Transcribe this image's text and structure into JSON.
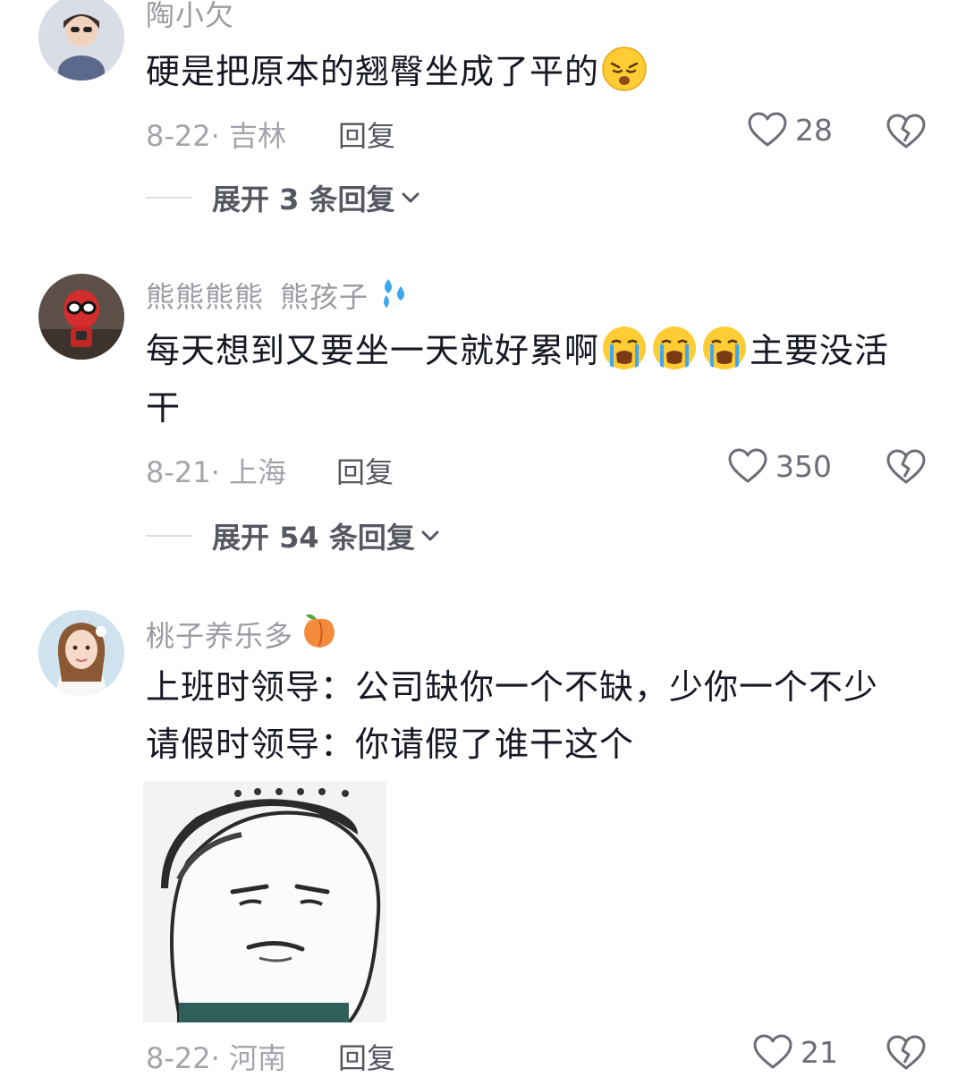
{
  "comments": [
    {
      "username": "陶小欠",
      "username_suffix": "",
      "text_before_emoji": "硬是把原本的翘臀坐成了平的",
      "emoji_icon": "tired-face-emoji",
      "date_location": "8-22· 吉林",
      "reply_label": "回复",
      "likes": "28",
      "expand_label": "展开 3 条回复"
    },
    {
      "username": "熊熊熊熊",
      "username_suffix": "熊孩子",
      "username_emoji": "sweat-droplets-emoji",
      "text_line1_before": "每天想到又要坐一天就好累啊",
      "emoji_icon": "loudly-crying-face-emoji",
      "text_line1_after": "主要没活",
      "text_line2": "干",
      "date_location": "8-21· 上海",
      "reply_label": "回复",
      "likes": "350",
      "expand_label": "展开 54 条回复"
    },
    {
      "username": "桃子养乐多",
      "username_emoji": "peach-emoji",
      "text_line1": "上班时领导：公司缺你一个不缺，少你一个不少",
      "text_line2": "请假时领导：你请假了谁干这个",
      "meme_image": "sticker-meme-face",
      "date_location": "8-22· 河南",
      "reply_label": "回复",
      "likes": "21"
    }
  ],
  "colors": {
    "text_primary": "#161823",
    "text_secondary": "#9a9ca3",
    "action_text": "#555861"
  }
}
